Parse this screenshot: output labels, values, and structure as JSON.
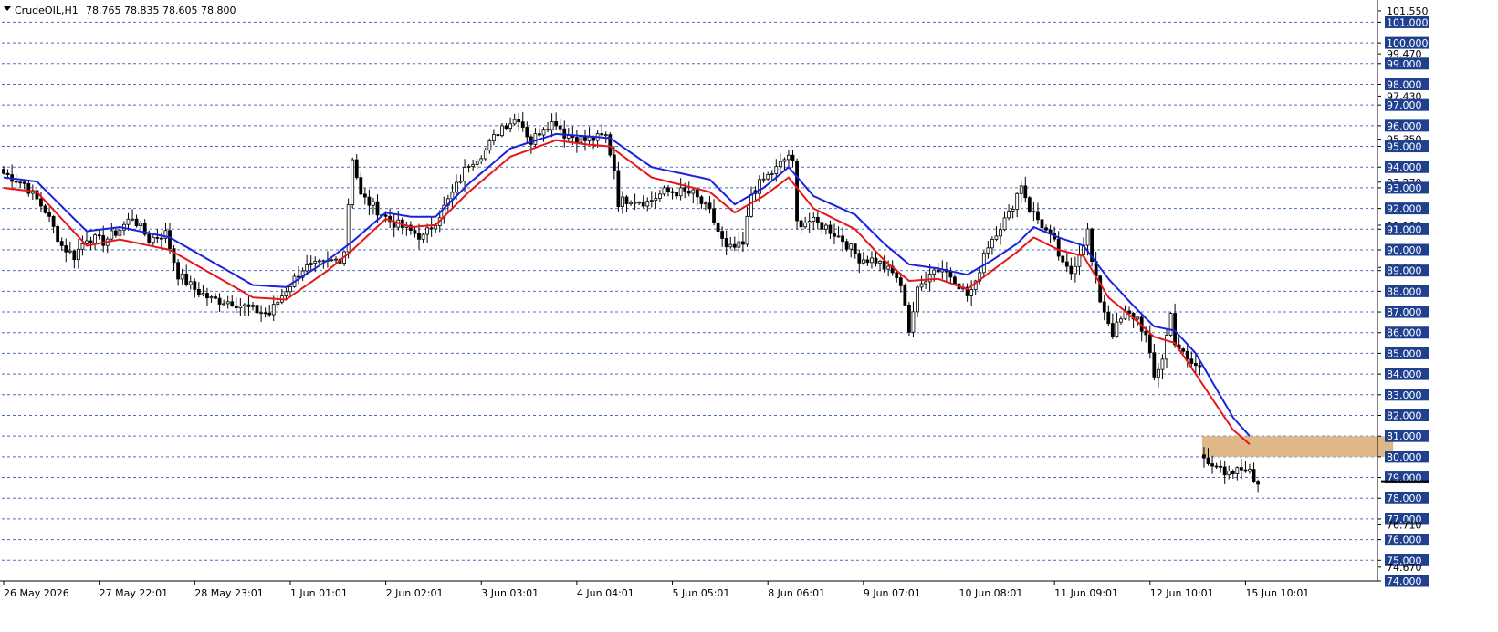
{
  "header": {
    "symbol_label": "CrudeOIL,H1",
    "ohlc_label": "78.765 78.835 78.605 78.800"
  },
  "colors": {
    "background": "#ffffff",
    "grid": "#4a6fb8",
    "ema_fast": "#e8161b",
    "ema_slow": "#1a22e0",
    "zone": "#deb887",
    "candle": "#000000",
    "price_box": "#1f3f8f"
  },
  "chart_data": {
    "type": "candlestick",
    "title": "CrudeOIL,H1",
    "xlabel": "",
    "ylabel": "",
    "ylim": [
      74.0,
      101.9
    ],
    "grid": true,
    "price_scale_labels": [
      {
        "value": 101.55,
        "text": "101.550",
        "boxed": false
      },
      {
        "value": 101.0,
        "text": "101.000",
        "boxed": true
      },
      {
        "value": 100.0,
        "text": "100.000",
        "boxed": true
      },
      {
        "value": 99.47,
        "text": "99.470",
        "boxed": false
      },
      {
        "value": 99.0,
        "text": "99.000",
        "boxed": true
      },
      {
        "value": 98.0,
        "text": "98.000",
        "boxed": true
      },
      {
        "value": 97.43,
        "text": "97.430",
        "boxed": false
      },
      {
        "value": 97.0,
        "text": "97.000",
        "boxed": true
      },
      {
        "value": 96.0,
        "text": "96.000",
        "boxed": true
      },
      {
        "value": 95.35,
        "text": "95.350",
        "boxed": false
      },
      {
        "value": 95.0,
        "text": "95.000",
        "boxed": true
      },
      {
        "value": 94.0,
        "text": "94.000",
        "boxed": true
      },
      {
        "value": 93.27,
        "text": "93.270",
        "boxed": false
      },
      {
        "value": 93.0,
        "text": "93.000",
        "boxed": true
      },
      {
        "value": 92.0,
        "text": "92.000",
        "boxed": true
      },
      {
        "value": 91.19,
        "text": "91.190",
        "boxed": false
      },
      {
        "value": 91.0,
        "text": "91.000",
        "boxed": true
      },
      {
        "value": 90.0,
        "text": "90.000",
        "boxed": true
      },
      {
        "value": 89.15,
        "text": "89.150",
        "boxed": false
      },
      {
        "value": 89.0,
        "text": "89.000",
        "boxed": true
      },
      {
        "value": 88.0,
        "text": "88.000",
        "boxed": true
      },
      {
        "value": 87.0,
        "text": "87.000",
        "boxed": true
      },
      {
        "value": 86.0,
        "text": "86.000",
        "boxed": true
      },
      {
        "value": 85.0,
        "text": "85.000",
        "boxed": true
      },
      {
        "value": 84.0,
        "text": "84.000",
        "boxed": true
      },
      {
        "value": 83.0,
        "text": "83.000",
        "boxed": true
      },
      {
        "value": 82.0,
        "text": "82.000",
        "boxed": true
      },
      {
        "value": 81.0,
        "text": "81.000",
        "boxed": true
      },
      {
        "value": 80.0,
        "text": "80.000",
        "boxed": true
      },
      {
        "value": 79.0,
        "text": "79.000",
        "boxed": true
      },
      {
        "value": 78.0,
        "text": "78.000",
        "boxed": true
      },
      {
        "value": 77.0,
        "text": "77.000",
        "boxed": true
      },
      {
        "value": 76.71,
        "text": "76.710",
        "boxed": false
      },
      {
        "value": 76.0,
        "text": "76.000",
        "boxed": true
      },
      {
        "value": 75.0,
        "text": "75.000",
        "boxed": true
      },
      {
        "value": 74.67,
        "text": "74.670",
        "boxed": false
      },
      {
        "value": 74.0,
        "text": "74.000",
        "boxed": true
      }
    ],
    "current_price": 78.8,
    "time_labels": [
      {
        "bar": 0,
        "text": "26 May 2026"
      },
      {
        "bar": 23,
        "text": "27 May 22:01"
      },
      {
        "bar": 46,
        "text": "28 May 23:01"
      },
      {
        "bar": 69,
        "text": "1 Jun 01:01"
      },
      {
        "bar": 92,
        "text": "2 Jun 02:01"
      },
      {
        "bar": 115,
        "text": "3 Jun 03:01"
      },
      {
        "bar": 138,
        "text": "4 Jun 04:01"
      },
      {
        "bar": 161,
        "text": "5 Jun 05:01"
      },
      {
        "bar": 184,
        "text": "8 Jun 06:01"
      },
      {
        "bar": 207,
        "text": "9 Jun 07:01"
      },
      {
        "bar": 230,
        "text": "10 Jun 08:01"
      },
      {
        "bar": 253,
        "text": "11 Jun 09:01"
      },
      {
        "bar": 276,
        "text": "12 Jun 10:01"
      },
      {
        "bar": 299,
        "text": "15 Jun 10:01"
      }
    ],
    "zone": {
      "bar_start": 289,
      "bar_end": 335,
      "price_low": 80.0,
      "price_high": 81.0
    },
    "bar_count": 336,
    "close_anchors": [
      [
        0,
        93.7
      ],
      [
        5,
        93.2
      ],
      [
        10,
        91.9
      ],
      [
        14,
        90.2
      ],
      [
        17,
        89.7
      ],
      [
        20,
        90.6
      ],
      [
        24,
        90.4
      ],
      [
        28,
        91.0
      ],
      [
        31,
        91.6
      ],
      [
        35,
        90.5
      ],
      [
        39,
        90.8
      ],
      [
        42,
        88.8
      ],
      [
        46,
        88.1
      ],
      [
        50,
        87.6
      ],
      [
        55,
        87.5
      ],
      [
        60,
        87.1
      ],
      [
        64,
        86.9
      ],
      [
        68,
        88.1
      ],
      [
        72,
        89.1
      ],
      [
        77,
        89.3
      ],
      [
        81,
        89.6
      ],
      [
        82,
        90.0
      ],
      [
        84,
        94.5
      ],
      [
        86,
        92.6
      ],
      [
        89,
        92.1
      ],
      [
        93,
        91.4
      ],
      [
        98,
        90.9
      ],
      [
        101,
        90.6
      ],
      [
        104,
        91.4
      ],
      [
        108,
        92.7
      ],
      [
        112,
        94.2
      ],
      [
        116,
        94.8
      ],
      [
        120,
        96.0
      ],
      [
        124,
        96.4
      ],
      [
        127,
        95.2
      ],
      [
        130,
        96.0
      ],
      [
        133,
        96.2
      ],
      [
        135,
        95.6
      ],
      [
        140,
        95.3
      ],
      [
        143,
        95.4
      ],
      [
        145,
        95.5
      ],
      [
        147,
        93.9
      ],
      [
        148,
        92.3
      ],
      [
        151,
        92.5
      ],
      [
        155,
        92.3
      ],
      [
        159,
        92.8
      ],
      [
        163,
        92.8
      ],
      [
        166,
        92.7
      ],
      [
        170,
        91.8
      ],
      [
        174,
        90.0
      ],
      [
        176,
        90.1
      ],
      [
        178,
        90.2
      ],
      [
        180,
        92.7
      ],
      [
        183,
        93.4
      ],
      [
        186,
        93.9
      ],
      [
        189,
        94.6
      ],
      [
        190,
        94.1
      ],
      [
        191,
        91.3
      ],
      [
        194,
        91.4
      ],
      [
        198,
        91.1
      ],
      [
        202,
        90.5
      ],
      [
        206,
        89.6
      ],
      [
        210,
        89.5
      ],
      [
        213,
        89.0
      ],
      [
        215,
        88.7
      ],
      [
        217,
        87.5
      ],
      [
        218,
        86.1
      ],
      [
        220,
        88.0
      ],
      [
        223,
        89.0
      ],
      [
        226,
        89.1
      ],
      [
        229,
        88.6
      ],
      [
        232,
        87.8
      ],
      [
        234,
        88.3
      ],
      [
        236,
        89.9
      ],
      [
        239,
        90.9
      ],
      [
        242,
        91.7
      ],
      [
        245,
        93.2
      ],
      [
        247,
        92.0
      ],
      [
        250,
        91.2
      ],
      [
        253,
        90.3
      ],
      [
        255,
        89.2
      ],
      [
        257,
        88.9
      ],
      [
        259,
        89.9
      ],
      [
        261,
        90.9
      ],
      [
        262,
        89.4
      ],
      [
        264,
        87.6
      ],
      [
        267,
        86.0
      ],
      [
        270,
        86.9
      ],
      [
        273,
        86.7
      ],
      [
        275,
        85.8
      ],
      [
        277,
        83.8
      ],
      [
        279,
        84.8
      ],
      [
        281,
        86.9
      ],
      [
        282,
        85.6
      ],
      [
        285,
        84.6
      ],
      [
        288,
        84.3
      ],
      [
        289,
        80.0
      ],
      [
        292,
        79.6
      ],
      [
        294,
        79.0
      ],
      [
        297,
        79.3
      ],
      [
        299,
        79.5
      ],
      [
        301,
        78.9
      ],
      [
        302,
        78.8
      ]
    ],
    "gaps": [
      [
        180,
        181
      ],
      [
        288,
        289
      ]
    ],
    "ema_fast": {
      "name": "",
      "anchors": [
        [
          0,
          93.0
        ],
        [
          8,
          92.8
        ],
        [
          20,
          90.2
        ],
        [
          28,
          90.5
        ],
        [
          40,
          90.0
        ],
        [
          60,
          87.7
        ],
        [
          68,
          87.6
        ],
        [
          78,
          89.0
        ],
        [
          84,
          90.0
        ],
        [
          92,
          91.5
        ],
        [
          98,
          91.1
        ],
        [
          104,
          91.2
        ],
        [
          112,
          92.8
        ],
        [
          122,
          94.5
        ],
        [
          133,
          95.3
        ],
        [
          140,
          95.1
        ],
        [
          146,
          95.0
        ],
        [
          156,
          93.5
        ],
        [
          170,
          92.8
        ],
        [
          176,
          91.8
        ],
        [
          183,
          92.6
        ],
        [
          189,
          93.5
        ],
        [
          195,
          92.0
        ],
        [
          205,
          91.0
        ],
        [
          212,
          89.5
        ],
        [
          218,
          88.5
        ],
        [
          225,
          88.6
        ],
        [
          232,
          88.1
        ],
        [
          238,
          89.0
        ],
        [
          244,
          89.9
        ],
        [
          248,
          90.6
        ],
        [
          254,
          90.0
        ],
        [
          260,
          89.7
        ],
        [
          266,
          87.7
        ],
        [
          272,
          86.7
        ],
        [
          277,
          85.8
        ],
        [
          282,
          85.5
        ],
        [
          287,
          84.0
        ],
        [
          296,
          81.3
        ],
        [
          300,
          80.6
        ]
      ]
    },
    "ema_slow": {
      "name": "",
      "anchors": [
        [
          0,
          93.5
        ],
        [
          8,
          93.3
        ],
        [
          20,
          90.9
        ],
        [
          28,
          91.1
        ],
        [
          40,
          90.6
        ],
        [
          60,
          88.3
        ],
        [
          68,
          88.2
        ],
        [
          78,
          89.5
        ],
        [
          84,
          90.4
        ],
        [
          92,
          91.8
        ],
        [
          98,
          91.6
        ],
        [
          104,
          91.6
        ],
        [
          112,
          93.2
        ],
        [
          122,
          94.9
        ],
        [
          133,
          95.6
        ],
        [
          140,
          95.5
        ],
        [
          146,
          95.4
        ],
        [
          156,
          94.0
        ],
        [
          170,
          93.4
        ],
        [
          176,
          92.2
        ],
        [
          183,
          93.0
        ],
        [
          189,
          94.0
        ],
        [
          195,
          92.6
        ],
        [
          205,
          91.7
        ],
        [
          212,
          90.3
        ],
        [
          218,
          89.3
        ],
        [
          225,
          89.1
        ],
        [
          232,
          88.8
        ],
        [
          238,
          89.5
        ],
        [
          244,
          90.3
        ],
        [
          248,
          91.1
        ],
        [
          254,
          90.6
        ],
        [
          260,
          90.2
        ],
        [
          266,
          88.6
        ],
        [
          272,
          87.3
        ],
        [
          277,
          86.3
        ],
        [
          282,
          86.1
        ],
        [
          287,
          85.0
        ],
        [
          296,
          81.9
        ],
        [
          300,
          81.0
        ]
      ]
    }
  }
}
